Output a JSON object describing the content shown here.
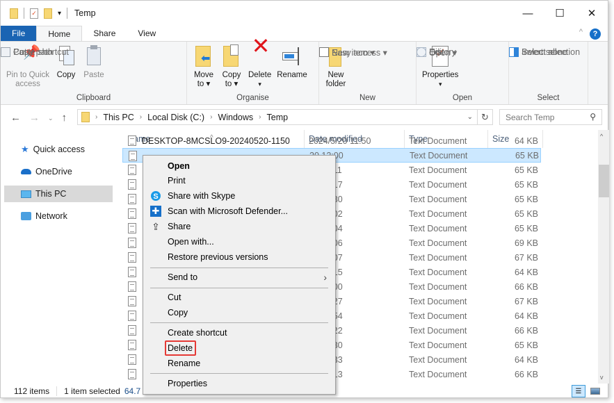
{
  "window": {
    "title": "Temp",
    "controls": {
      "minimize": "—",
      "maximize": "☐",
      "close": "✕"
    }
  },
  "ribbon_tabs": [
    {
      "label": "File"
    },
    {
      "label": "Home"
    },
    {
      "label": "Share"
    },
    {
      "label": "View"
    }
  ],
  "ribbon": {
    "clipboard": {
      "label": "Clipboard",
      "pin": "Pin to Quick access",
      "pin_line1": "Pin to Quick",
      "pin_line2": "access",
      "copy": "Copy",
      "paste": "Paste",
      "cut": "Cut",
      "copy_path": "Copy path",
      "paste_shortcut": "Paste shortcut"
    },
    "organise": {
      "label": "Organise",
      "move_to": "Move",
      "move_to2": "to ▾",
      "copy_to": "Copy",
      "copy_to2": "to ▾",
      "delete": "Delete",
      "delete2": "▾",
      "rename": "Rename"
    },
    "new": {
      "label": "New",
      "new_folder": "New",
      "new_folder2": "folder",
      "new_item": "New item ▾",
      "easy_access": "Easy access ▾"
    },
    "open": {
      "label": "Open",
      "properties": "Properties",
      "properties2": "▾",
      "open": "Open ▾",
      "edit": "Edit",
      "history": "History"
    },
    "select": {
      "label": "Select",
      "select_all": "Select all",
      "select_none": "Select none",
      "invert": "Invert selection"
    }
  },
  "address": {
    "crumbs": [
      "This PC",
      "Local Disk (C:)",
      "Windows",
      "Temp"
    ],
    "search_placeholder": "Search Temp"
  },
  "sidebar": {
    "items": [
      {
        "label": "Quick access"
      },
      {
        "label": "OneDrive"
      },
      {
        "label": "This PC",
        "selected": true
      },
      {
        "label": "Network"
      }
    ]
  },
  "columns": {
    "name": "Name",
    "date": "Date modified",
    "type": "Type",
    "size": "Size"
  },
  "files": [
    {
      "name": "DESKTOP-8MCSLO9-20240520-1150",
      "date": "2024/5/20 11:50",
      "type": "Text Document",
      "size": "64 KB"
    },
    {
      "name": "",
      "date": "20 12:00",
      "type": "Text Document",
      "size": "65 KB",
      "selected": true
    },
    {
      "name": "",
      "date": "20 12:11",
      "type": "Text Document",
      "size": "65 KB"
    },
    {
      "name": "",
      "date": "20 12:17",
      "type": "Text Document",
      "size": "65 KB"
    },
    {
      "name": "",
      "date": "20 12:30",
      "type": "Text Document",
      "size": "65 KB"
    },
    {
      "name": "",
      "date": "20 13:02",
      "type": "Text Document",
      "size": "65 KB"
    },
    {
      "name": "",
      "date": "20 13:04",
      "type": "Text Document",
      "size": "65 KB"
    },
    {
      "name": "",
      "date": "20 13:06",
      "type": "Text Document",
      "size": "69 KB"
    },
    {
      "name": "",
      "date": "20 13:07",
      "type": "Text Document",
      "size": "67 KB"
    },
    {
      "name": "",
      "date": "20 13:15",
      "type": "Text Document",
      "size": "64 KB"
    },
    {
      "name": "",
      "date": "20 14:00",
      "type": "Text Document",
      "size": "66 KB"
    },
    {
      "name": "",
      "date": "20 14:27",
      "type": "Text Document",
      "size": "67 KB"
    },
    {
      "name": "",
      "date": "20 14:54",
      "type": "Text Document",
      "size": "64 KB"
    },
    {
      "name": "",
      "date": "20 15:22",
      "type": "Text Document",
      "size": "66 KB"
    },
    {
      "name": "",
      "date": "20 15:30",
      "type": "Text Document",
      "size": "65 KB"
    },
    {
      "name": "",
      "date": "20 15:33",
      "type": "Text Document",
      "size": "64 KB"
    },
    {
      "name": "",
      "date": "20 16:13",
      "type": "Text Document",
      "size": "66 KB"
    }
  ],
  "context_menu": {
    "items": [
      {
        "label": "Open",
        "bold": true
      },
      {
        "label": "Print"
      },
      {
        "label": "Share with Skype",
        "icon": "skype-icon"
      },
      {
        "label": "Scan with Microsoft Defender...",
        "icon": "defender-icon"
      },
      {
        "label": "Share",
        "icon": "share-icon"
      },
      {
        "label": "Open with..."
      },
      {
        "label": "Restore previous versions"
      },
      {
        "label": "Send to",
        "submenu": true
      },
      {
        "label": "Cut"
      },
      {
        "label": "Copy"
      },
      {
        "label": "Create shortcut"
      },
      {
        "label": "Delete",
        "highlighted": true
      },
      {
        "label": "Rename"
      },
      {
        "label": "Properties"
      }
    ]
  },
  "status": {
    "count": "112 items",
    "selected": "1 item selected",
    "size": "64.7 KB"
  },
  "colors": {
    "file_tab": "#1a64b3",
    "selection": "#cce8ff",
    "highlight_box": "#e53935"
  }
}
